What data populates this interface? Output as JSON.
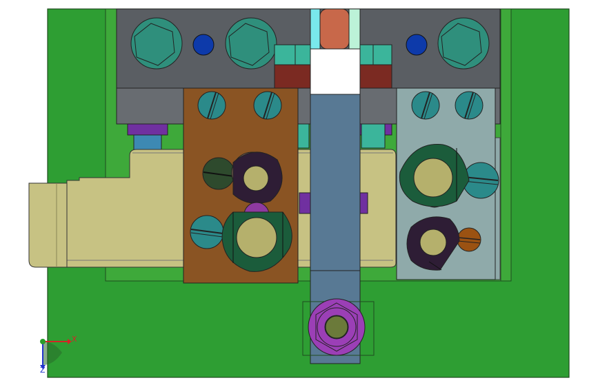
{
  "viewport": {
    "background": "#ffffff"
  },
  "colors": {
    "base_plate": "#2e9e33",
    "die_shoe": "#3ea93a",
    "block_dark": "#5a5e63",
    "block_light": "#686c71",
    "slider": "#c7c283",
    "slider_dark": "#b1ad73",
    "left_plate": "#8a5423",
    "right_plate": "#8faaaa",
    "punch": "#587994",
    "punch_top": "#ffffff",
    "hex_bolt": "#2f8f7c",
    "screw": "#2b8a8a",
    "dowel": "#0d3aaa",
    "guide_pin_blue": "#3d89b3",
    "guide_pin_purple": "#7030a0",
    "nut_purple": "#9b3fb6",
    "hole_fill": "#b5b06c",
    "ring_dark": "#1b5c3b",
    "ring_black": "#2e1d35",
    "teal_block": "#3bb59b",
    "brown_block": "#7b2a22",
    "copper": "#c8684a",
    "cyan_strip": "#79e8ec",
    "mint_strip": "#bcf2d8",
    "orange_screw": "#9b5212"
  },
  "triad": {
    "x_label": "X",
    "y_label": "Y",
    "z_label": "Z",
    "x_color": "#d42626",
    "y_color": "#2a9d2a",
    "z_color": "#2233cc"
  }
}
